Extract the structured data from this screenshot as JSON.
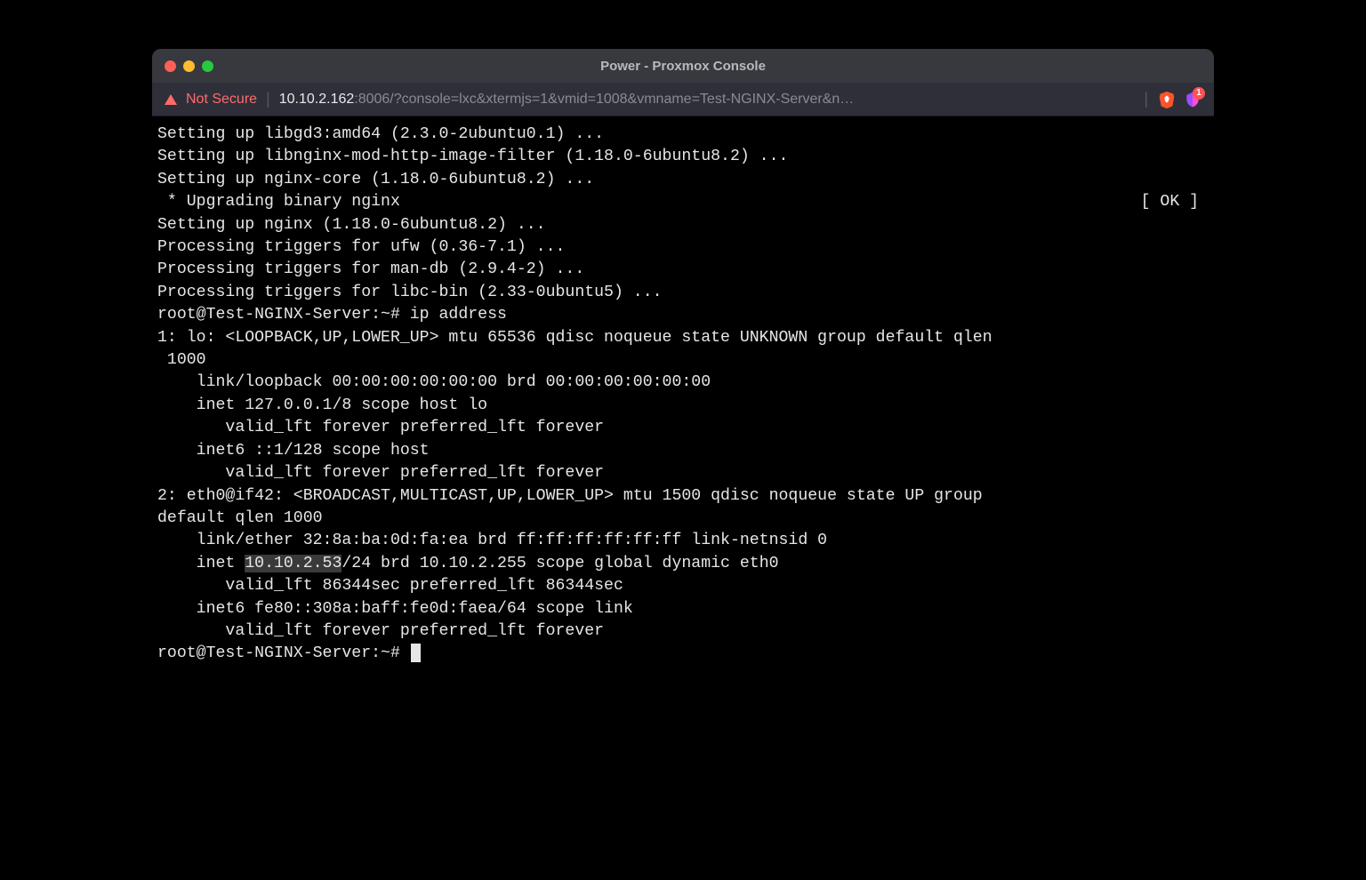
{
  "window_title": "Power - Proxmox Console",
  "url": {
    "not_secure": "Not Secure",
    "host": "10.10.2.162",
    "rest": ":8006/?console=lxc&xtermjs=1&vmid=1008&vmname=Test-NGINX-Server&n…"
  },
  "ext_badge_count": "1",
  "terminal": {
    "lines": [
      "Setting up libgd3:amd64 (2.3.0-2ubuntu0.1) ...",
      "Setting up libnginx-mod-http-image-filter (1.18.0-6ubuntu8.2) ...",
      "Setting up nginx-core (1.18.0-6ubuntu8.2) ..."
    ],
    "ok_row_left": " * Upgrading binary nginx",
    "ok_row_right": "[ OK ] ",
    "lines2": [
      "Setting up nginx (1.18.0-6ubuntu8.2) ...",
      "Processing triggers for ufw (0.36-7.1) ...",
      "Processing triggers for man-db (2.9.4-2) ...",
      "Processing triggers for libc-bin (2.33-0ubuntu5) ...",
      "root@Test-NGINX-Server:~# ip address",
      "1: lo: <LOOPBACK,UP,LOWER_UP> mtu 65536 qdisc noqueue state UNKNOWN group default qlen",
      " 1000",
      "    link/loopback 00:00:00:00:00:00 brd 00:00:00:00:00:00",
      "    inet 127.0.0.1/8 scope host lo",
      "       valid_lft forever preferred_lft forever",
      "    inet6 ::1/128 scope host ",
      "       valid_lft forever preferred_lft forever",
      "2: eth0@if42: <BROADCAST,MULTICAST,UP,LOWER_UP> mtu 1500 qdisc noqueue state UP group ",
      "default qlen 1000",
      "    link/ether 32:8a:ba:0d:fa:ea brd ff:ff:ff:ff:ff:ff link-netnsid 0"
    ],
    "highlight_prefix": "    inet ",
    "highlight_ip": "10.10.2.53",
    "highlight_suffix": "/24 brd 10.10.2.255 scope global dynamic eth0",
    "lines3": [
      "       valid_lft 86344sec preferred_lft 86344sec",
      "    inet6 fe80::308a:baff:fe0d:faea/64 scope link ",
      "       valid_lft forever preferred_lft forever"
    ],
    "prompt": "root@Test-NGINX-Server:~# "
  }
}
